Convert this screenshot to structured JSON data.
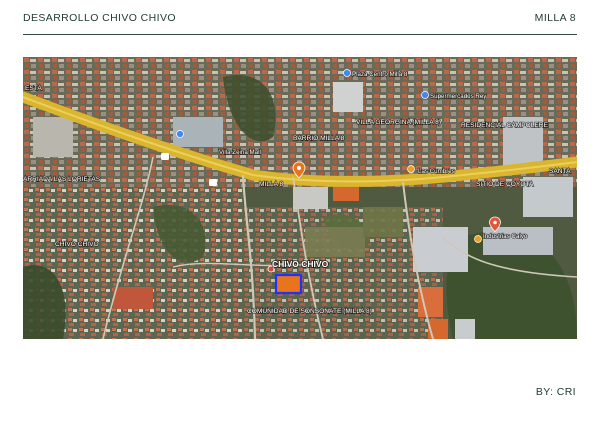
{
  "header": {
    "project_title": "DESARROLLO CHIVO CHIVO",
    "section_label": "MILLA 8"
  },
  "footer": {
    "credit": "BY: CRI"
  },
  "map": {
    "road_color": "#d9b62e",
    "highlight_color": "#2230ff",
    "pin_color": "#e8741b",
    "labels": {
      "chivo_chivo": "CHIVO CHIVO",
      "comunidad": "COMUNIDAD DE SONSONATE (MILLA 8)",
      "barrio_milla": "BARRIO MILLA 8",
      "villa_georgina": "VILLA GEORGINA (MILLA 8)",
      "residencial": "RESIDENCIAL CAMPOLERE",
      "milla": "MILLA 8",
      "sitio_coyota": "SITIO DE COYOTA",
      "las_cumbres": "Las Cumbres",
      "barrio_las_lorietas": "ARRIADA LAS LORIETAS",
      "chivo_chivo_small": "CHIVO CHIVO",
      "plaza_centro": "Plaza Centro Milla 8",
      "supermercados": "Supermercados Rey",
      "villa_zeina": "Villa Zeina Mall",
      "industrias": "Industrias Calvo",
      "edge_left": "ESTA",
      "edge_right": "SANTA"
    }
  }
}
